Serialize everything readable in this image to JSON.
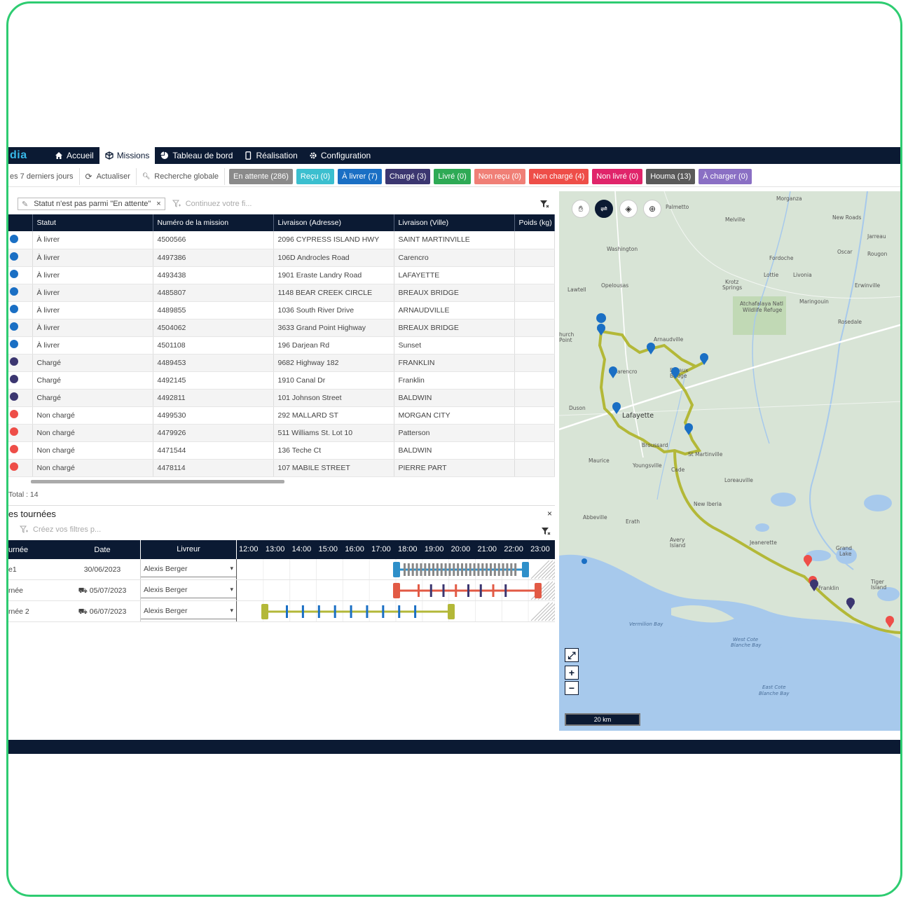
{
  "nav": {
    "logo": "dia",
    "items": [
      {
        "label": "Accueil",
        "icon": "home-icon"
      },
      {
        "label": "Missions",
        "icon": "cube-icon",
        "active": true
      },
      {
        "label": "Tableau de bord",
        "icon": "pie-chart-icon"
      },
      {
        "label": "Réalisation",
        "icon": "mobile-icon"
      },
      {
        "label": "Configuration",
        "icon": "gear-icon"
      }
    ]
  },
  "toolbar": {
    "period": "es 7 derniers jours",
    "refresh": "Actualiser",
    "search": "Recherche globale",
    "chips": [
      {
        "label": "En attente (286)",
        "color": "#8a8a8a"
      },
      {
        "label": "Reçu (0)",
        "color": "#3bbfcf"
      },
      {
        "label": "À livrer (7)",
        "color": "#1a6fc4"
      },
      {
        "label": "Chargé (3)",
        "color": "#3b3670"
      },
      {
        "label": "Livré (0)",
        "color": "#2eaa55"
      },
      {
        "label": "Non reçu (0)",
        "color": "#f07f76"
      },
      {
        "label": "Non chargé (4)",
        "color": "#ee4e48"
      },
      {
        "label": "Non livré (0)",
        "color": "#e0246a"
      },
      {
        "label": "Houma (13)",
        "color": "#5a5a5a"
      },
      {
        "label": "À charger (0)",
        "color": "#8a6fc4"
      }
    ]
  },
  "filter": {
    "tag": "Statut n'est pas parmi \"En attente\"",
    "placeholder": "Continuez votre fi..."
  },
  "grid": {
    "headers": [
      "Statut",
      "Numéro de la mission",
      "Livraison (Adresse)",
      "Livraison (Ville)",
      "Poids (kg)"
    ],
    "rows": [
      {
        "color": "#1a6fc4",
        "statut": "À livrer",
        "num": "4500566",
        "adresse": "2096 CYPRESS ISLAND HWY",
        "ville": "SAINT MARTINVILLE"
      },
      {
        "color": "#1a6fc4",
        "statut": "À livrer",
        "num": "4497386",
        "adresse": "106D Androcles Road",
        "ville": "Carencro"
      },
      {
        "color": "#1a6fc4",
        "statut": "À livrer",
        "num": "4493438",
        "adresse": "1901 Eraste Landry Road",
        "ville": "LAFAYETTE"
      },
      {
        "color": "#1a6fc4",
        "statut": "À livrer",
        "num": "4485807",
        "adresse": "1148 BEAR CREEK CIRCLE",
        "ville": "BREAUX BRIDGE"
      },
      {
        "color": "#1a6fc4",
        "statut": "À livrer",
        "num": "4489855",
        "adresse": "1036 South River Drive",
        "ville": "ARNAUDVILLE"
      },
      {
        "color": "#1a6fc4",
        "statut": "À livrer",
        "num": "4504062",
        "adresse": "3633 Grand Point Highway",
        "ville": "BREAUX BRIDGE"
      },
      {
        "color": "#1a6fc4",
        "statut": "À livrer",
        "num": "4501108",
        "adresse": "196 Darjean Rd",
        "ville": "Sunset"
      },
      {
        "color": "#3b3670",
        "statut": "Chargé",
        "num": "4489453",
        "adresse": "9682 Highway 182",
        "ville": "FRANKLIN"
      },
      {
        "color": "#3b3670",
        "statut": "Chargé",
        "num": "4492145",
        "adresse": "1910 Canal Dr",
        "ville": "Franklin"
      },
      {
        "color": "#3b3670",
        "statut": "Chargé",
        "num": "4492811",
        "adresse": "101 Johnson Street",
        "ville": "BALDWIN"
      },
      {
        "color": "#ee4e48",
        "statut": "Non chargé",
        "num": "4499530",
        "adresse": "292 MALLARD ST",
        "ville": "MORGAN CITY"
      },
      {
        "color": "#ee4e48",
        "statut": "Non chargé",
        "num": "4479926",
        "adresse": "511 Williams St. Lot 10",
        "ville": "Patterson"
      },
      {
        "color": "#ee4e48",
        "statut": "Non chargé",
        "num": "4471544",
        "adresse": "136 Teche Ct",
        "ville": "BALDWIN"
      },
      {
        "color": "#ee4e48",
        "statut": "Non chargé",
        "num": "4478114",
        "adresse": "107 MABILE STREET",
        "ville": "PIERRE PART"
      }
    ],
    "total": "Total : 14"
  },
  "tours": {
    "title": "es tournées",
    "filter_placeholder": "Créez vos filtres p...",
    "headers": {
      "tournee": "urnée",
      "date": "Date",
      "livreur": "Livreur"
    },
    "hours": [
      "12:00",
      "13:00",
      "14:00",
      "15:00",
      "16:00",
      "17:00",
      "18:00",
      "19:00",
      "20:00",
      "21:00",
      "22:00",
      "23:00"
    ],
    "rows": [
      {
        "tournee": "e1",
        "date": "30/06/2023",
        "livreur": "Alexis Berger",
        "truck": false,
        "color": "#2e8fc9"
      },
      {
        "tournee": "rnée",
        "date": "05/07/2023",
        "livreur": "Alexis Berger",
        "truck": true,
        "color": "#e25a45"
      },
      {
        "tournee": "rnée 2",
        "date": "06/07/2023",
        "livreur": "Alexis Berger",
        "truck": true,
        "color": "#b3b838"
      }
    ]
  },
  "map": {
    "scale": "20 km",
    "labels": [
      "Lafayette",
      "Arnaudville",
      "Breaux Bridge",
      "New Iberia",
      "Washington",
      "Opelousas",
      "Melville",
      "Palmetto",
      "Morganza",
      "Lottie",
      "Livonia",
      "Fordoche",
      "Krotz Springs",
      "Maringouin",
      "Rosedale",
      "Erwinville",
      "Duson",
      "Maurice",
      "Youngsville",
      "Broussard",
      "St Martinville",
      "Loreauville",
      "Abbeville",
      "Erath",
      "Jeanerette",
      "Franklin",
      "Avery Island",
      "Vermilion Bay",
      "West Cote Blanche Bay",
      "East Cote Blanche Bay",
      "Atchafalaya Natl Wildlife Refuge",
      "Cade",
      "Carencro",
      "Lawtell",
      "Church Point",
      "Grand Lake",
      "Tiger Island",
      "New Roads",
      "Jarreau",
      "Oscar",
      "Rougon"
    ]
  }
}
